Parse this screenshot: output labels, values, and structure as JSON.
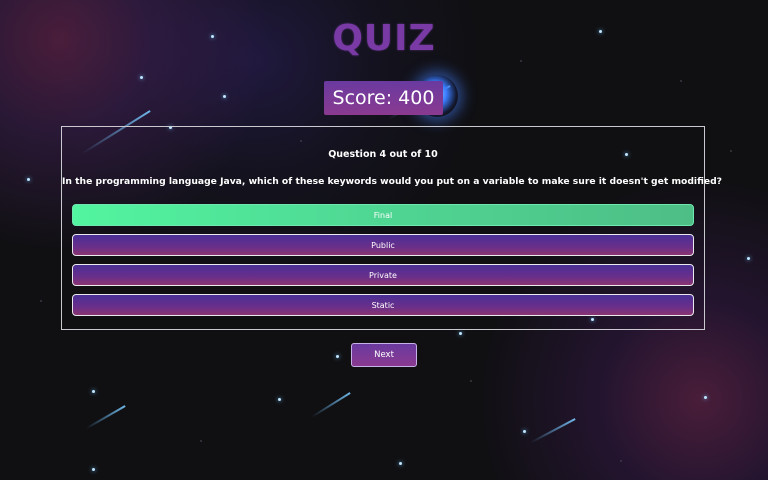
{
  "header": {
    "title": "QUIZ"
  },
  "score": {
    "label": "Score: 400"
  },
  "question": {
    "counter": "Question 4 out of 10",
    "text": "In the programming language Java, which of these keywords would you put on a variable to make sure it doesn't get modified?"
  },
  "answers": [
    {
      "label": "Final",
      "state": "correct"
    },
    {
      "label": "Public",
      "state": "default"
    },
    {
      "label": "Private",
      "state": "default"
    },
    {
      "label": "Static",
      "state": "default"
    }
  ],
  "controls": {
    "next_label": "Next"
  },
  "colors": {
    "title": "#7a3aa6",
    "accent_purple": "#6a3aa0",
    "correct_green": "#52f5a0",
    "panel_border": "#c9c9cf",
    "background": "#101013"
  }
}
